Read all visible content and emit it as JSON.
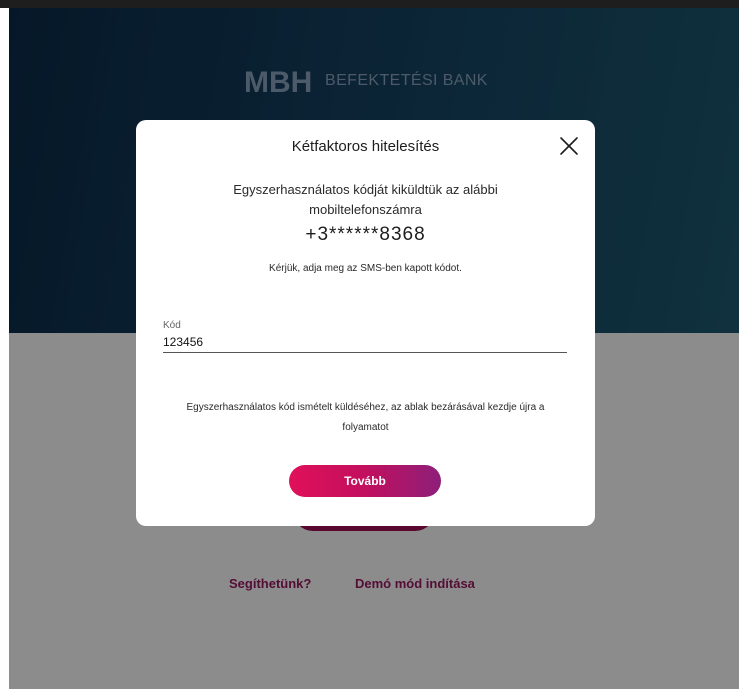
{
  "brand": {
    "logo": "MBH",
    "name": "BEFEKTETÉSI BANK"
  },
  "background_links": {
    "help": "Segíthetünk?",
    "demo": "Demó mód indítása"
  },
  "modal": {
    "title": "Kétfaktoros hitelesítés",
    "close_icon": "close-icon",
    "message": "Egyszerhasználatos kódját kiküldtük az alábbi mobiltelefonszámra",
    "phone": "+3******8368",
    "instruction": "Kérjük, adja meg az SMS-ben kapott kódot.",
    "code_field": {
      "label": "Kód",
      "value": "123456"
    },
    "resend_note": "Egyszerhasználatos kód ismételt küldéséhez, az ablak bezárásával kezdje újra a folyamatot",
    "continue_button": "Tovább"
  },
  "colors": {
    "hero": "#164564",
    "accent": "#e0105a",
    "accent_end": "#8d1f79",
    "link": "#9a1a63"
  }
}
